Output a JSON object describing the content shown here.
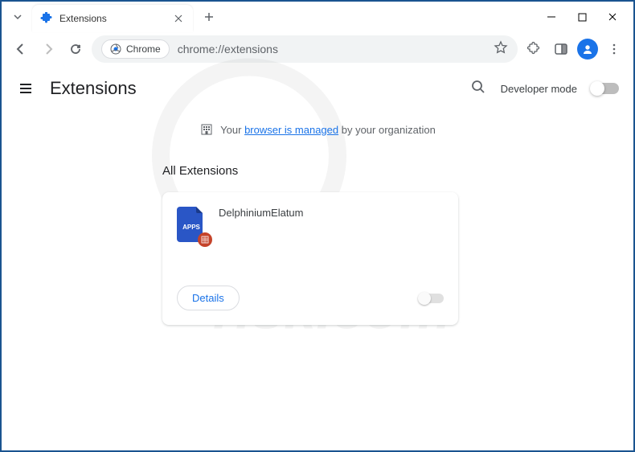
{
  "window": {
    "tab_title": "Extensions",
    "minimize": "–",
    "maximize": "☐",
    "close": "✕"
  },
  "toolbar": {
    "chip_label": "Chrome",
    "url": "chrome://extensions"
  },
  "header": {
    "title": "Extensions",
    "dev_mode_label": "Developer mode"
  },
  "banner": {
    "prefix": "Your ",
    "link": "browser is managed",
    "suffix": " by your organization"
  },
  "content": {
    "section_title": "All Extensions",
    "extensions": [
      {
        "name": "DelphiniumElatum",
        "icon_label": "APPS",
        "details_label": "Details",
        "enabled": false
      }
    ]
  }
}
